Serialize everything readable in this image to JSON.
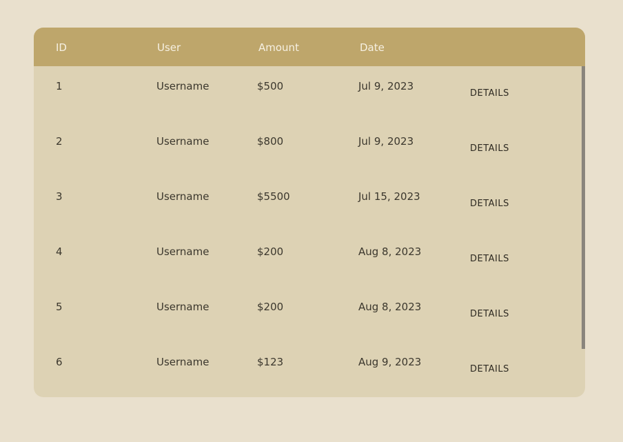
{
  "table": {
    "columns": [
      "ID",
      "User",
      "Amount",
      "Date"
    ],
    "rows": [
      {
        "id": "1",
        "user": "Username",
        "amount": "$500",
        "date": "Jul 9, 2023",
        "action": "DETAILS"
      },
      {
        "id": "2",
        "user": "Username",
        "amount": "$800",
        "date": "Jul 9, 2023",
        "action": "DETAILS"
      },
      {
        "id": "3",
        "user": "Username",
        "amount": "$5500",
        "date": "Jul 15, 2023",
        "action": "DETAILS"
      },
      {
        "id": "4",
        "user": "Username",
        "amount": "$200",
        "date": "Aug 8, 2023",
        "action": "DETAILS"
      },
      {
        "id": "5",
        "user": "Username",
        "amount": "$200",
        "date": "Aug 8, 2023",
        "action": "DETAILS"
      },
      {
        "id": "6",
        "user": "Username",
        "amount": "$123",
        "date": "Aug 9, 2023",
        "action": "DETAILS"
      }
    ]
  },
  "colors": {
    "page_background": "#e9e0cd",
    "header_background": "#bea66b",
    "body_background": "#ddd2b4",
    "header_text": "#f6f0e2",
    "body_text": "#3b372d",
    "scrollbar": "#8a857c"
  }
}
